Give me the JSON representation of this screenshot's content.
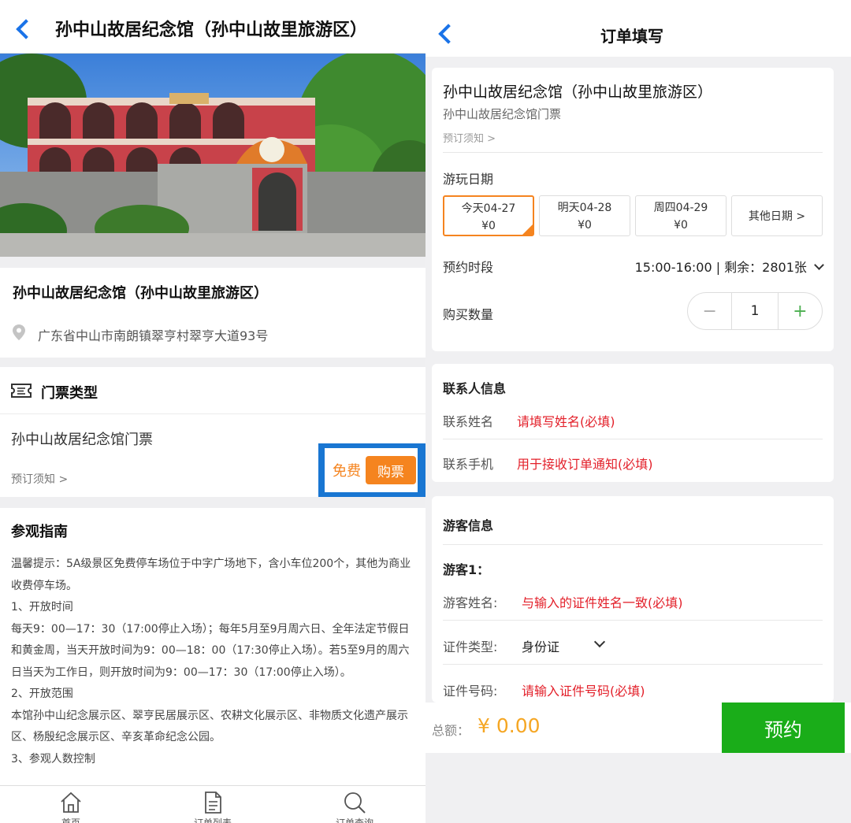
{
  "left": {
    "nav": {
      "title": "孙中山故居纪念馆（孙中山故里旅游区）"
    },
    "info": {
      "name": "孙中山故居纪念馆（孙中山故里旅游区）",
      "address": "广东省中山市南朗镇翠亨村翠亨大道93号"
    },
    "tickets": {
      "section_label": "门票类型",
      "ticket_name": "孙中山故居纪念馆门票",
      "notice": "预订须知 >",
      "price": "免费",
      "buy_label": "购票"
    },
    "guide": {
      "title": "参观指南",
      "lines": [
        "温馨提示：5A级景区免费停车场位于中字广场地下，含小车位200个，其他为商业收费停车场。",
        "1、开放时间",
        "每天9：00—17：30（17:00停止入场）；每年5月至9月周六日、全年法定节假日和黄金周，当天开放时间为9：00—18：00（17:30停止入场）。若5至9月的周六日当天为工作日，则开放时间为9：00—17：30（17:00停止入场）。",
        "2、开放范围",
        "本馆孙中山纪念展示区、翠亨民居展示区、农耕文化展示区、非物质文化遗产展示区、杨殷纪念展示区、辛亥革命纪念公园。",
        "3、参观人数控制"
      ]
    },
    "tabbar": {
      "home": "首页",
      "orders": "订单列表",
      "query": "订单查询"
    }
  },
  "right": {
    "nav": {
      "title": "订单填写"
    },
    "ticket": {
      "name": "孙中山故居纪念馆（孙中山故里旅游区）",
      "sub": "孙中山故居纪念馆门票",
      "notice": "预订须知 >"
    },
    "date_label": "游玩日期",
    "dates": [
      {
        "day": "今天04-27",
        "price": "¥0"
      },
      {
        "day": "明天04-28",
        "price": "¥0"
      },
      {
        "day": "周四04-29",
        "price": "¥0"
      }
    ],
    "other_dates": "其他日期 >",
    "slot_label": "预约时段",
    "slot_value": "15:00-16:00 | 剩余：2801张",
    "qty_label": "购买数量",
    "qty_minus": "−",
    "qty_value": "1",
    "qty_plus": "+",
    "contact": {
      "title": "联系人信息",
      "name_label": "联系姓名",
      "name_placeholder": "请填写姓名(必填)",
      "phone_label": "联系手机",
      "phone_placeholder": "用于接收订单通知(必填)"
    },
    "visitor": {
      "title": "游客信息",
      "label": "游客1：",
      "name_label": "游客姓名:",
      "name_placeholder": "与输入的证件姓名一致(必填)",
      "idtype_label": "证件类型:",
      "idtype_value": "身份证",
      "idno_label": "证件号码:",
      "idno_placeholder": "请输入证件号码(必填)"
    },
    "total_label": "总额：",
    "total_value": "¥ 0.00",
    "book_label": "预约"
  },
  "colors": {
    "accent_blue": "#1a73e8",
    "orange": "#f5841f",
    "green": "#1aad19",
    "red_hint": "#e3202a"
  }
}
